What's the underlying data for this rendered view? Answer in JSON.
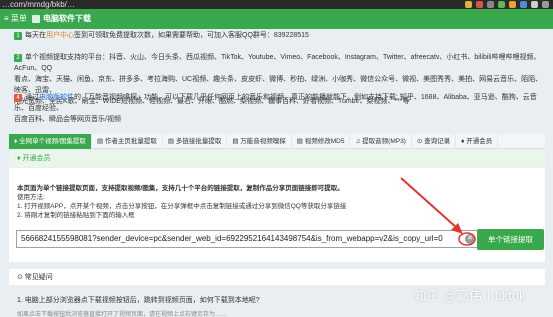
{
  "browser": {
    "url_fragment": "…com/mmdg/bkb/…",
    "icon_colors": [
      "#e0b33a",
      "#d9534f",
      "#888888",
      "#5cb85c",
      "#f0a030",
      "#4a90d9",
      "#cccccc",
      "#999999"
    ]
  },
  "topbar": {
    "menu_label": "≡ 菜单",
    "title": "电脑软件下载"
  },
  "notices": {
    "n1": {
      "num": "1",
      "pre": "每天在",
      "link": "用户中心",
      "post": "签到可领取免费提取次数，如果需要帮助，可加入客服QQ群号：839228515"
    },
    "n2": {
      "num": "2",
      "line1": "单个视频提取支持的平台：抖音、火山、今日头条、西瓜视频、TikTok、Youtube、Vimeo、Facebook、Instagram、Twitter、afreecatv、小红书、bilibili哔哩哔哩视频、AcFun、QQ",
      "line2": "看点、海宝、天猫、闲鱼、京东、拼多多、考拉海购、UC视频、趣头条、皮皮虾、微博、秒拍、绿洲、小咖秀、微信公众号、微视、美图秀秀、美拍、网易云音乐、陌陌、映客、迅雷、",
      "line3": "阳光宽频、全民K歌、刷宝、WIDE短视频、轻视频、最右、开眼、酷燃、梨视频、糖事百科、好看视频、Tumblr、梨视频、***等"
    },
    "n4": {
      "num": "4",
      "pre": "通过",
      "link1": "电脑版软件",
      "mid": "的「万能音视频嗅探」功能，可以下载几乎任何网页上的音乐和视频，真正的能播就能下。例如支持下载: 知乎、1688、Alibaba、亚马逊、酷狗、云音乐、百度经验、",
      "line2": "百度百科、瞬品会等网页音乐/视频"
    }
  },
  "tabs": [
    {
      "label": "♦ 全网单个视频/图集提取",
      "active": true
    },
    {
      "label": "▤ 作者主页批量提取",
      "active": false
    },
    {
      "label": "▤ 多链接批量提取",
      "active": false
    },
    {
      "label": "▤ 万能音视频嗅探",
      "active": false
    },
    {
      "label": "▤ 视频修改MD5",
      "active": false
    },
    {
      "label": "♫ 提取音频(MP3)",
      "active": false
    },
    {
      "label": "⊙ 查询记录",
      "active": false
    },
    {
      "label": "♦ 开通会员",
      "active": false
    }
  ],
  "open_member_header": "♦ 开通会员",
  "panel": {
    "headline": "本页面为单个链接提取页面，支持提取视频/图集，支持几十个平台的链接提取，复制作品分享页面链接即可提取。",
    "usage_title": "使用方法:",
    "step1": "1. 打开视频APP，点开某个视频，点击分享按钮，在分享弹框中点击复制链接或通过分享到微信QQ等获取分享链接",
    "step2": "2. 将刚才复制的链接粘贴到下面的输入框"
  },
  "link_input": {
    "value": "5666824155598081?sender_device=pc&sender_web_id=6922952164143498754&is_from_webapp=v2&is_copy_url=0"
  },
  "clear_symbol": "✕",
  "extract_button": "单个链接提取",
  "faq": {
    "header": "⊙ 常见疑问",
    "q1": "1. 电脑上部分浏览器点下载视频按钮后，跳转到视频页面，如何下载到本地呢?",
    "a1": "如果点击下载按钮后浏览器直接打开了视频页面，请在视频上点右键另存为……"
  },
  "watermark": "知乎 @嘉伟丨tiktok",
  "colors": {
    "primary_green": "#3aa94d",
    "arrow_red": "#e0362b",
    "link_orange": "#e2812b"
  }
}
